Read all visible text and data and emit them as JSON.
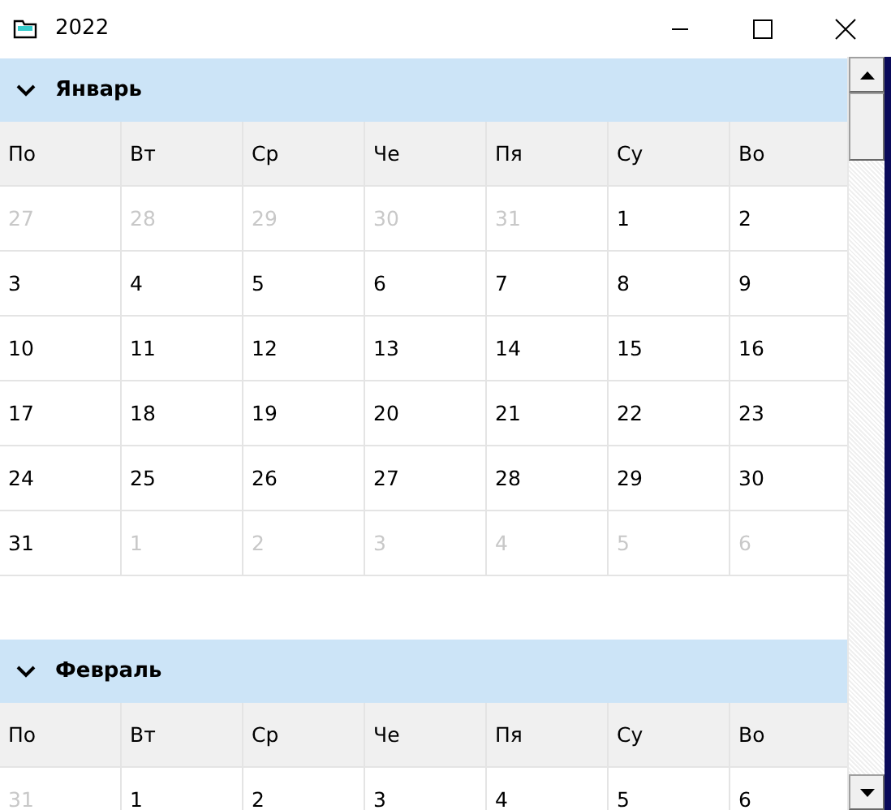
{
  "window": {
    "title": "2022"
  },
  "months": [
    {
      "name": "Январь",
      "expanded": true,
      "weekdays": [
        "По",
        "Вт",
        "Ср",
        "Че",
        "Пя",
        "Су",
        "Во"
      ],
      "weeks": [
        [
          {
            "day": "27",
            "outside": true
          },
          {
            "day": "28",
            "outside": true
          },
          {
            "day": "29",
            "outside": true
          },
          {
            "day": "30",
            "outside": true
          },
          {
            "day": "31",
            "outside": true
          },
          {
            "day": "1",
            "outside": false
          },
          {
            "day": "2",
            "outside": false
          }
        ],
        [
          {
            "day": "3",
            "outside": false
          },
          {
            "day": "4",
            "outside": false
          },
          {
            "day": "5",
            "outside": false
          },
          {
            "day": "6",
            "outside": false
          },
          {
            "day": "7",
            "outside": false
          },
          {
            "day": "8",
            "outside": false
          },
          {
            "day": "9",
            "outside": false
          }
        ],
        [
          {
            "day": "10",
            "outside": false
          },
          {
            "day": "11",
            "outside": false
          },
          {
            "day": "12",
            "outside": false
          },
          {
            "day": "13",
            "outside": false
          },
          {
            "day": "14",
            "outside": false
          },
          {
            "day": "15",
            "outside": false
          },
          {
            "day": "16",
            "outside": false
          }
        ],
        [
          {
            "day": "17",
            "outside": false
          },
          {
            "day": "18",
            "outside": false
          },
          {
            "day": "19",
            "outside": false
          },
          {
            "day": "20",
            "outside": false
          },
          {
            "day": "21",
            "outside": false
          },
          {
            "day": "22",
            "outside": false
          },
          {
            "day": "23",
            "outside": false
          }
        ],
        [
          {
            "day": "24",
            "outside": false
          },
          {
            "day": "25",
            "outside": false
          },
          {
            "day": "26",
            "outside": false
          },
          {
            "day": "27",
            "outside": false
          },
          {
            "day": "28",
            "outside": false
          },
          {
            "day": "29",
            "outside": false
          },
          {
            "day": "30",
            "outside": false
          }
        ],
        [
          {
            "day": "31",
            "outside": false
          },
          {
            "day": "1",
            "outside": true
          },
          {
            "day": "2",
            "outside": true
          },
          {
            "day": "3",
            "outside": true
          },
          {
            "day": "4",
            "outside": true
          },
          {
            "day": "5",
            "outside": true
          },
          {
            "day": "6",
            "outside": true
          }
        ]
      ]
    },
    {
      "name": "Февраль",
      "expanded": true,
      "weekdays": [
        "По",
        "Вт",
        "Ср",
        "Че",
        "Пя",
        "Су",
        "Во"
      ],
      "weeks": [
        [
          {
            "day": "31",
            "outside": true
          },
          {
            "day": "1",
            "outside": false
          },
          {
            "day": "2",
            "outside": false
          },
          {
            "day": "3",
            "outside": false
          },
          {
            "day": "4",
            "outside": false
          },
          {
            "day": "5",
            "outside": false
          },
          {
            "day": "6",
            "outside": false
          }
        ]
      ]
    }
  ]
}
